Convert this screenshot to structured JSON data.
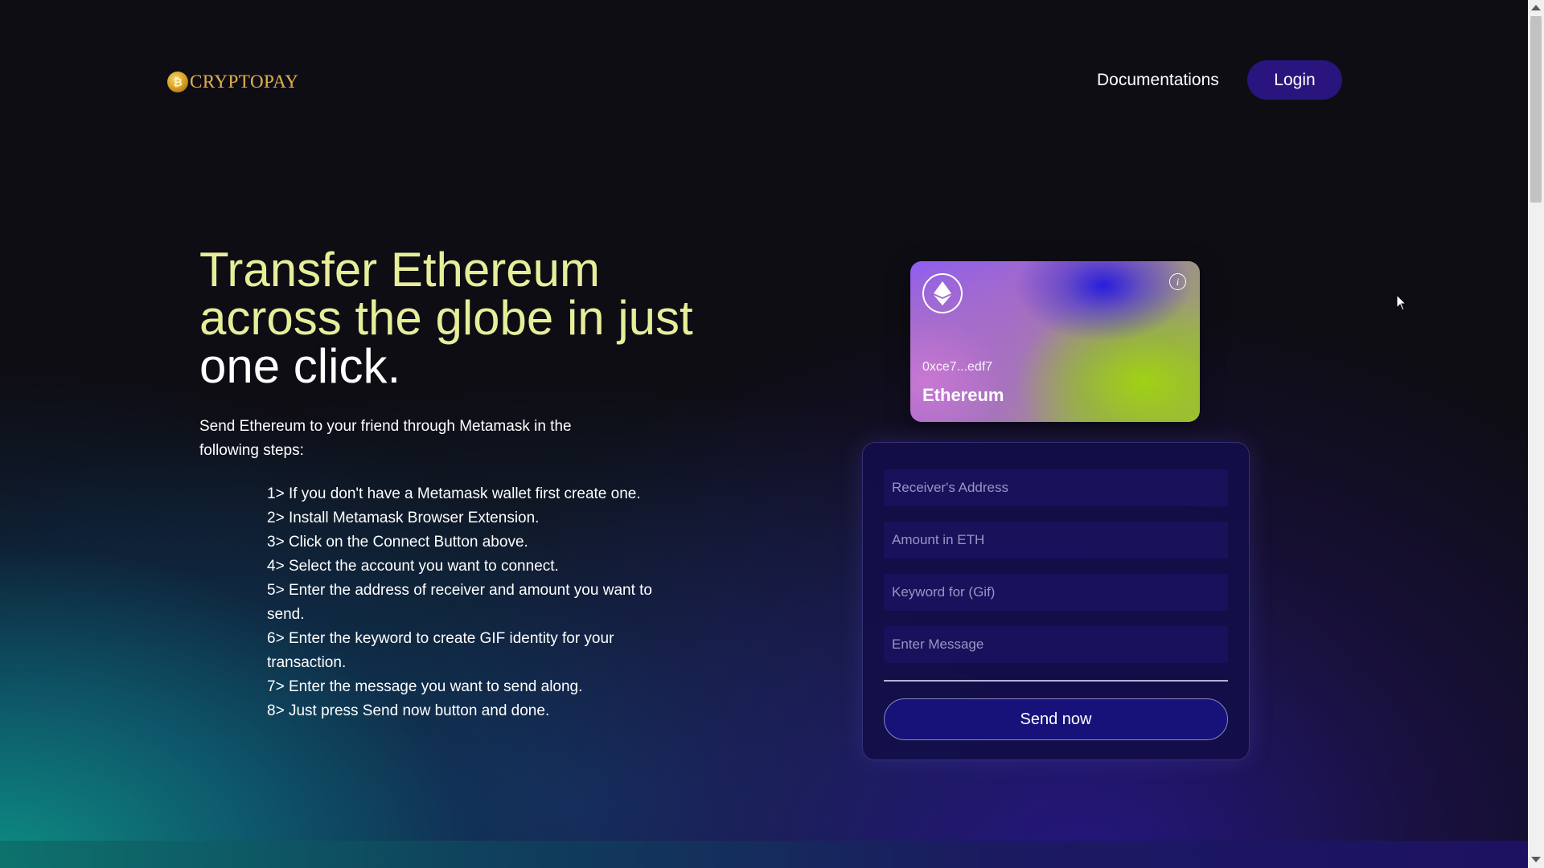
{
  "brand": {
    "name": "CRYPTOPAY",
    "coin_glyph": "₿"
  },
  "nav": {
    "documentations": "Documentations",
    "login": "Login"
  },
  "hero": {
    "title_line1": "Transfer Ethereum",
    "title_line2": "across the globe in just",
    "title_line3": "one click.",
    "intro": "Send Ethereum to your friend through Metamask in the following steps:",
    "steps": [
      "1> If you don't have a Metamask wallet first create one.",
      "2> Install Metamask Browser Extension.",
      "3> Click on the Connect Button above.",
      "4> Select the account you want to connect.",
      "5> Enter the address of receiver and amount you want to send.",
      "6> Enter the keyword to create GIF identity for your transaction.",
      "7> Enter the message you want to send along.",
      "8> Just press Send now button and done."
    ]
  },
  "card": {
    "address": "0xce7...edf7",
    "network": "Ethereum",
    "logo_icon": "ethereum-icon",
    "info_icon": "info-icon",
    "info_glyph": "i"
  },
  "form": {
    "receiver_placeholder": "Receiver's Address",
    "receiver_value": "",
    "amount_placeholder": "Amount in ETH",
    "amount_value": "",
    "keyword_placeholder": "Keyword for (Gif)",
    "keyword_value": "",
    "message_placeholder": "Enter Message",
    "message_value": "",
    "send_label": "Send now"
  },
  "colors": {
    "accent_title": "#e7ee9a",
    "login_bg": "#2a157f",
    "form_bg": "#120e48",
    "logo_gold": "#d9a94a"
  }
}
